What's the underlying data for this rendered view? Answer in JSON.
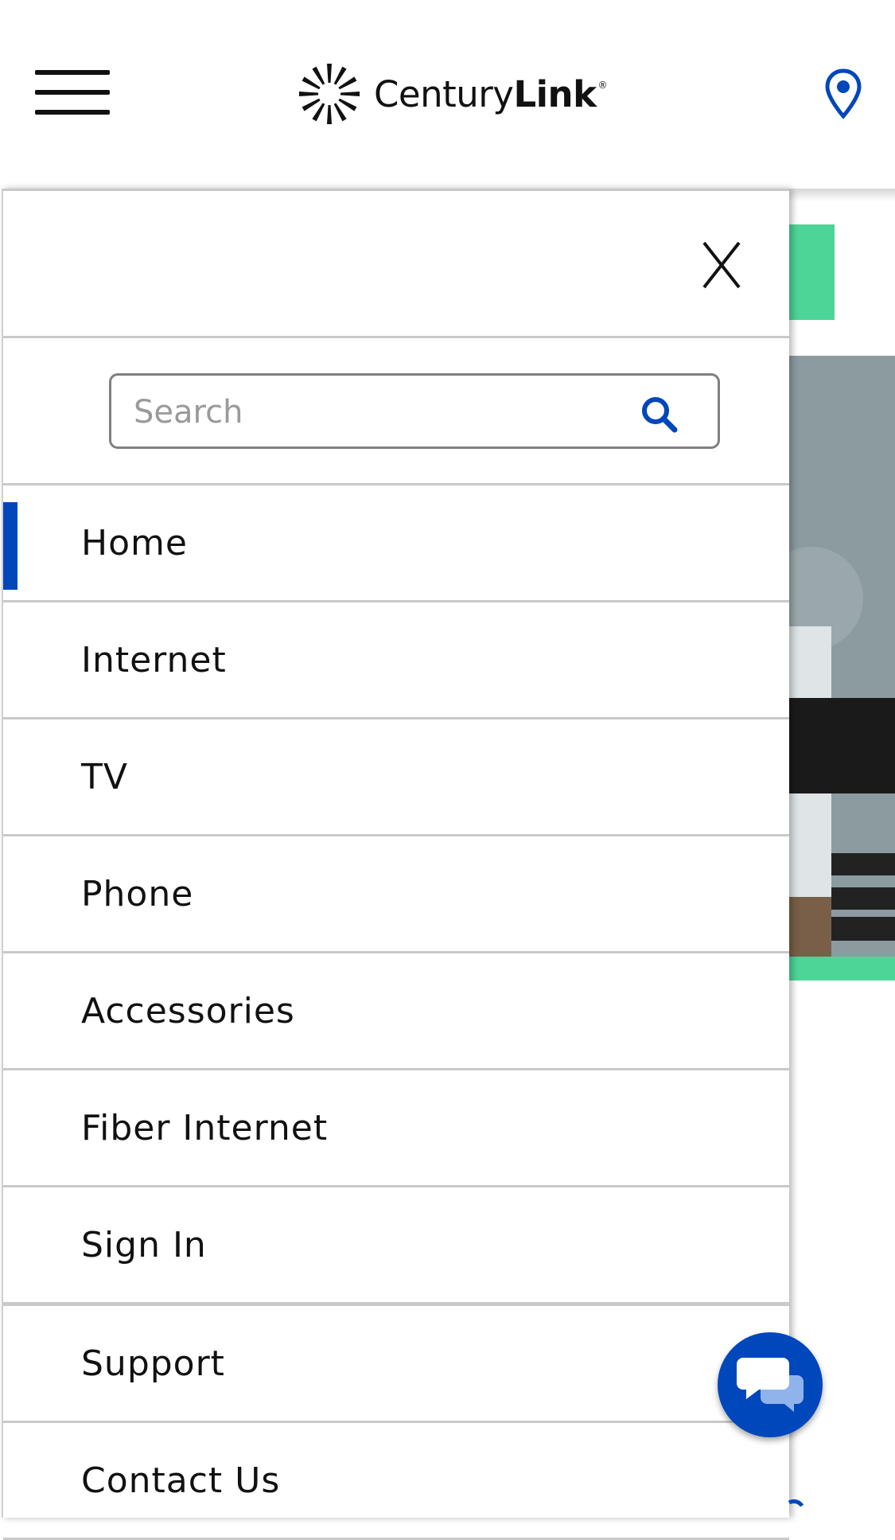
{
  "header": {
    "brand_regular": "Century",
    "brand_bold": "Link",
    "brand_mark": "®",
    "menu_icon": "hamburger-menu-icon",
    "location_icon": "location-pin-icon"
  },
  "drawer": {
    "close_label": "X",
    "search": {
      "placeholder": "Search",
      "value": "",
      "icon": "search-icon"
    },
    "items": [
      {
        "label": "Home",
        "active": true
      },
      {
        "label": "Internet"
      },
      {
        "label": "TV"
      },
      {
        "label": "Phone"
      },
      {
        "label": "Accessories"
      },
      {
        "label": "Fiber Internet"
      },
      {
        "label": "Sign In"
      },
      {
        "label": "Support"
      },
      {
        "label": "Contact Us"
      }
    ]
  },
  "chat": {
    "icon": "chat-bubbles-icon"
  },
  "colors": {
    "accent_blue": "#0047bb",
    "green": "#4dd597",
    "divider": "#c9c9c9"
  }
}
